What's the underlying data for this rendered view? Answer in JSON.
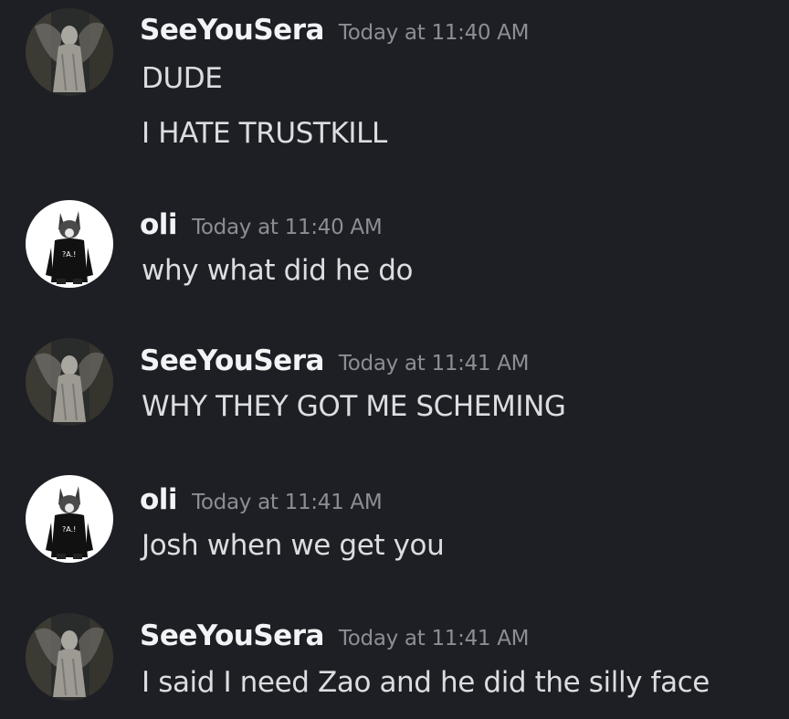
{
  "messages": [
    {
      "author": "SeeYouSera",
      "timestamp": "Today at 11:40 AM",
      "avatar_icon": "angel-statue-avatar",
      "lines": [
        "DUDE",
        "I HATE TRUSTKILL"
      ]
    },
    {
      "author": "oli",
      "timestamp": "Today at 11:40 AM",
      "avatar_icon": "cat-hoodie-avatar",
      "lines": [
        "why what did he do"
      ]
    },
    {
      "author": "SeeYouSera",
      "timestamp": "Today at 11:41 AM",
      "avatar_icon": "angel-statue-avatar",
      "lines": [
        "WHY THEY GOT ME SCHEMING"
      ]
    },
    {
      "author": "oli",
      "timestamp": "Today at 11:41 AM",
      "avatar_icon": "cat-hoodie-avatar",
      "lines": [
        "Josh when we get you"
      ]
    },
    {
      "author": "SeeYouSera",
      "timestamp": "Today at 11:41 AM",
      "avatar_icon": "angel-statue-avatar",
      "lines": [
        "I said I need Zao and he did the silly face"
      ]
    }
  ],
  "colors": {
    "background": "#1e1f24",
    "username": "#f2f3f5",
    "timestamp": "#8b8e96",
    "message_text": "#dbdee1"
  }
}
